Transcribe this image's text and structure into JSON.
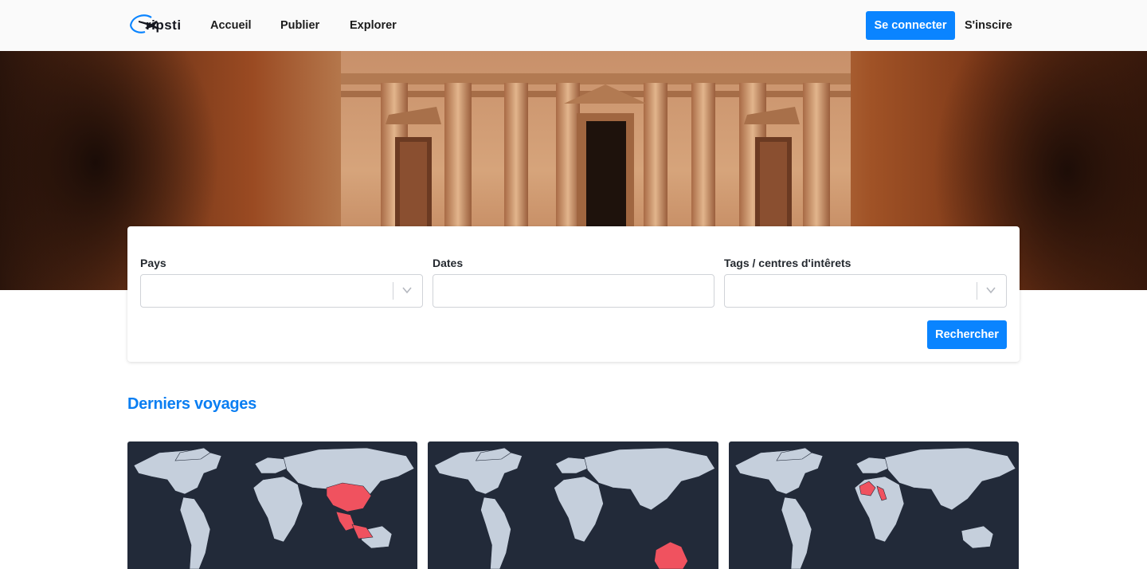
{
  "app": {
    "logo_text": "ripsti"
  },
  "header": {
    "nav": [
      {
        "label": "Accueil"
      },
      {
        "label": "Publier"
      },
      {
        "label": "Explorer"
      }
    ],
    "login_label": "Se connecter",
    "signup_label": "S'inscire"
  },
  "search": {
    "country_label": "Pays",
    "country_value": "",
    "dates_label": "Dates",
    "dates_value": "",
    "tags_label": "Tags / centres d'intêrets",
    "tags_value": "",
    "submit_label": "Rechercher"
  },
  "latest": {
    "title": "Derniers voyages",
    "trips": [
      {
        "highlight": "East & Southeast Asia"
      },
      {
        "highlight": "Australia"
      },
      {
        "highlight": "Southern Europe"
      }
    ]
  },
  "colors": {
    "accent": "#0a84ff",
    "title": "#0a7ef2",
    "map_bg": "#222a39",
    "land": "#c5cfdc",
    "highlight": "#f0525f"
  }
}
